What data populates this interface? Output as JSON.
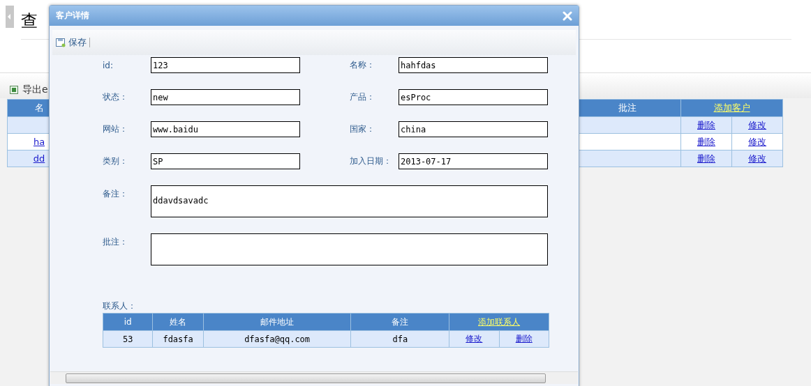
{
  "page": {
    "title": "查",
    "export_label": "导出e",
    "table": {
      "columns": [
        "名",
        "",
        "批注",
        "添加客户"
      ],
      "rows": [
        {
          "name": "",
          "actions": [
            "删除",
            "修改"
          ]
        },
        {
          "name": "ha",
          "actions": [
            "删除",
            "修改"
          ]
        },
        {
          "name": "dd",
          "actions": [
            "删除",
            "修改"
          ]
        }
      ]
    }
  },
  "dialog": {
    "title": "客户详情",
    "save_label": "保存",
    "fields": [
      {
        "label": "id:",
        "value": "123"
      },
      {
        "label": "名称：",
        "value": "hahfdas"
      },
      {
        "label": "状态：",
        "value": "new"
      },
      {
        "label": "产品：",
        "value": "esProc"
      },
      {
        "label": "网站：",
        "value": "www.baidu"
      },
      {
        "label": "国家：",
        "value": "china"
      },
      {
        "label": "类别：",
        "value": "SP"
      },
      {
        "label": "加入日期：",
        "value": "2013-07-17"
      }
    ],
    "textareas": [
      {
        "label": "备注：",
        "value": "ddavdsavadc"
      },
      {
        "label": "批注："
      }
    ],
    "contacts_label": "联系人：",
    "contacts": {
      "columns": [
        "id",
        "姓名",
        "邮件地址",
        "备注",
        "添加联系人"
      ],
      "rows": [
        {
          "cells": [
            "53",
            "fdasfa",
            "dfasfa@qq.com",
            "dfa"
          ],
          "actions": [
            "修改",
            "删除"
          ]
        }
      ]
    }
  }
}
